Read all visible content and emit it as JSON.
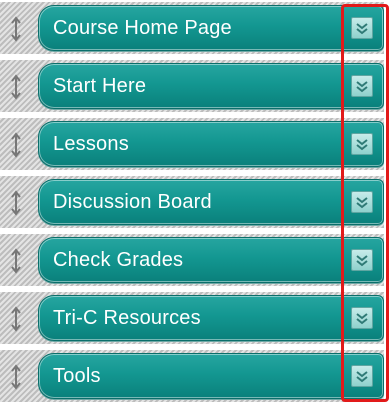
{
  "menu": {
    "items": [
      {
        "label": "Course Home Page",
        "handle_icon": "drag-handle-icon",
        "action_icon": "chevron-down-icon"
      },
      {
        "label": "Start Here",
        "handle_icon": "drag-handle-icon",
        "action_icon": "chevron-down-icon"
      },
      {
        "label": "Lessons",
        "handle_icon": "drag-handle-icon",
        "action_icon": "chevron-down-icon"
      },
      {
        "label": "Discussion Board",
        "handle_icon": "drag-handle-icon",
        "action_icon": "chevron-down-icon"
      },
      {
        "label": "Check Grades",
        "handle_icon": "drag-handle-icon",
        "action_icon": "chevron-down-icon"
      },
      {
        "label": "Tri-C Resources",
        "handle_icon": "drag-handle-icon",
        "action_icon": "chevron-down-icon"
      },
      {
        "label": "Tools",
        "handle_icon": "drag-handle-icon",
        "action_icon": "chevron-down-icon"
      }
    ]
  },
  "colors": {
    "button": "#139791",
    "chevron_box": "#a8dedb",
    "highlight": "#e21a1a"
  }
}
